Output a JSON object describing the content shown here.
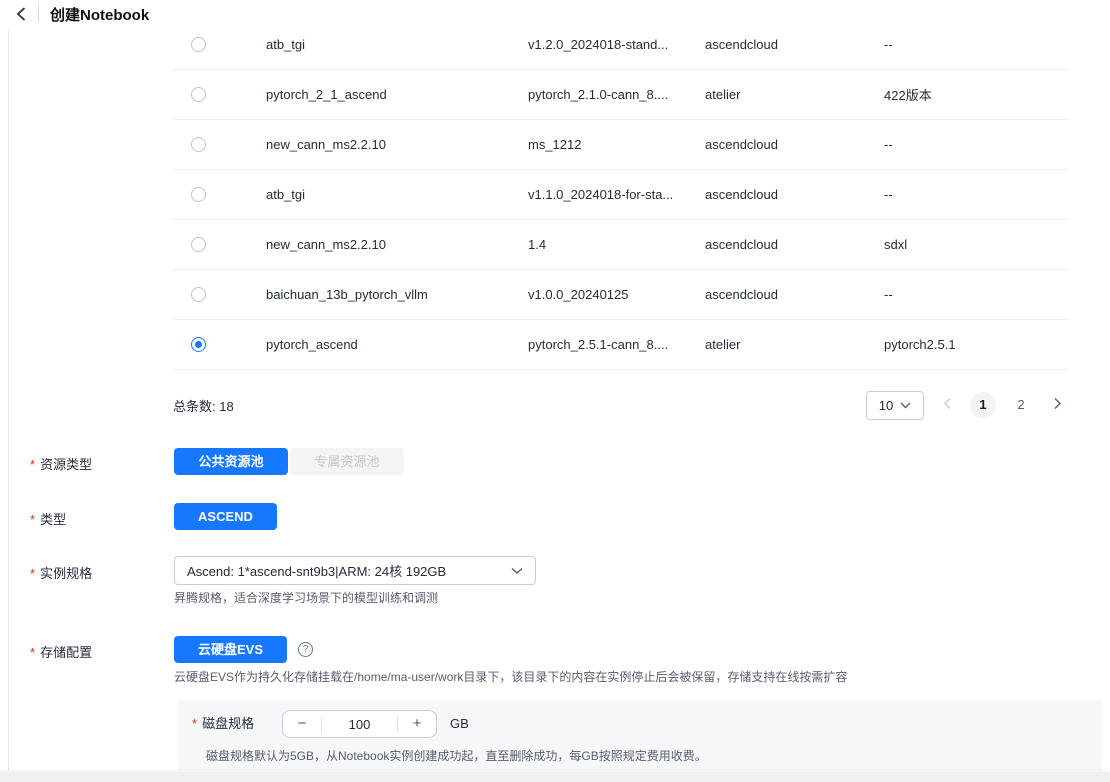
{
  "header": {
    "title": "创建Notebook"
  },
  "table": {
    "rows": [
      {
        "name": "atb_tgi",
        "version": "v1.2.0_2024018-stand...",
        "source": "ascendcloud",
        "extra": "--",
        "selected": false
      },
      {
        "name": "pytorch_2_1_ascend",
        "version": "pytorch_2.1.0-cann_8....",
        "source": "atelier",
        "extra": "422版本",
        "selected": false
      },
      {
        "name": "new_cann_ms2.2.10",
        "version": "ms_1212",
        "source": "ascendcloud",
        "extra": "--",
        "selected": false
      },
      {
        "name": "atb_tgi",
        "version": "v1.1.0_2024018-for-sta...",
        "source": "ascendcloud",
        "extra": "--",
        "selected": false
      },
      {
        "name": "new_cann_ms2.2.10",
        "version": "1.4",
        "source": "ascendcloud",
        "extra": "sdxl",
        "selected": false
      },
      {
        "name": "baichuan_13b_pytorch_vllm",
        "version": "v1.0.0_20240125",
        "source": "ascendcloud",
        "extra": "--",
        "selected": false
      },
      {
        "name": "pytorch_ascend",
        "version": "pytorch_2.5.1-cann_8....",
        "source": "atelier",
        "extra": "pytorch2.5.1",
        "selected": true
      }
    ],
    "pagination": {
      "total_label": "总条数:",
      "total_value": "18",
      "page_size": "10",
      "pages": [
        "1",
        "2"
      ],
      "current_page": "1"
    }
  },
  "form": {
    "resource_type": {
      "label": "资源类型",
      "option_public": "公共资源池",
      "option_dedicated": "专属资源池"
    },
    "type": {
      "label": "类型",
      "value": "ASCEND"
    },
    "instance_spec": {
      "label": "实例规格",
      "value": "Ascend: 1*ascend-snt9b3|ARM: 24核 192GB",
      "hint": "昇腾规格，适合深度学习场景下的模型训练和调测"
    },
    "storage": {
      "label": "存储配置",
      "value": "云硬盘EVS",
      "help_icon": "?",
      "hint": "云硬盘EVS作为持久化存储挂载在/home/ma-user/work目录下，该目录下的内容在实例停止后会被保留，存储支持在线按需扩容"
    },
    "disk": {
      "label": "磁盘规格",
      "value": "100",
      "unit": "GB",
      "minus": "−",
      "plus": "+",
      "hint": "磁盘规格默认为5GB，从Notebook实例创建成功起，直至删除成功，每GB按照规定费用收费。"
    }
  },
  "colors": {
    "primary_blue": "#1677ff",
    "required_red": "#e02e24",
    "disabled_text": "#c3c7ce",
    "hint_gray": "#575d6c",
    "panel_gray": "#f6f7f9"
  }
}
